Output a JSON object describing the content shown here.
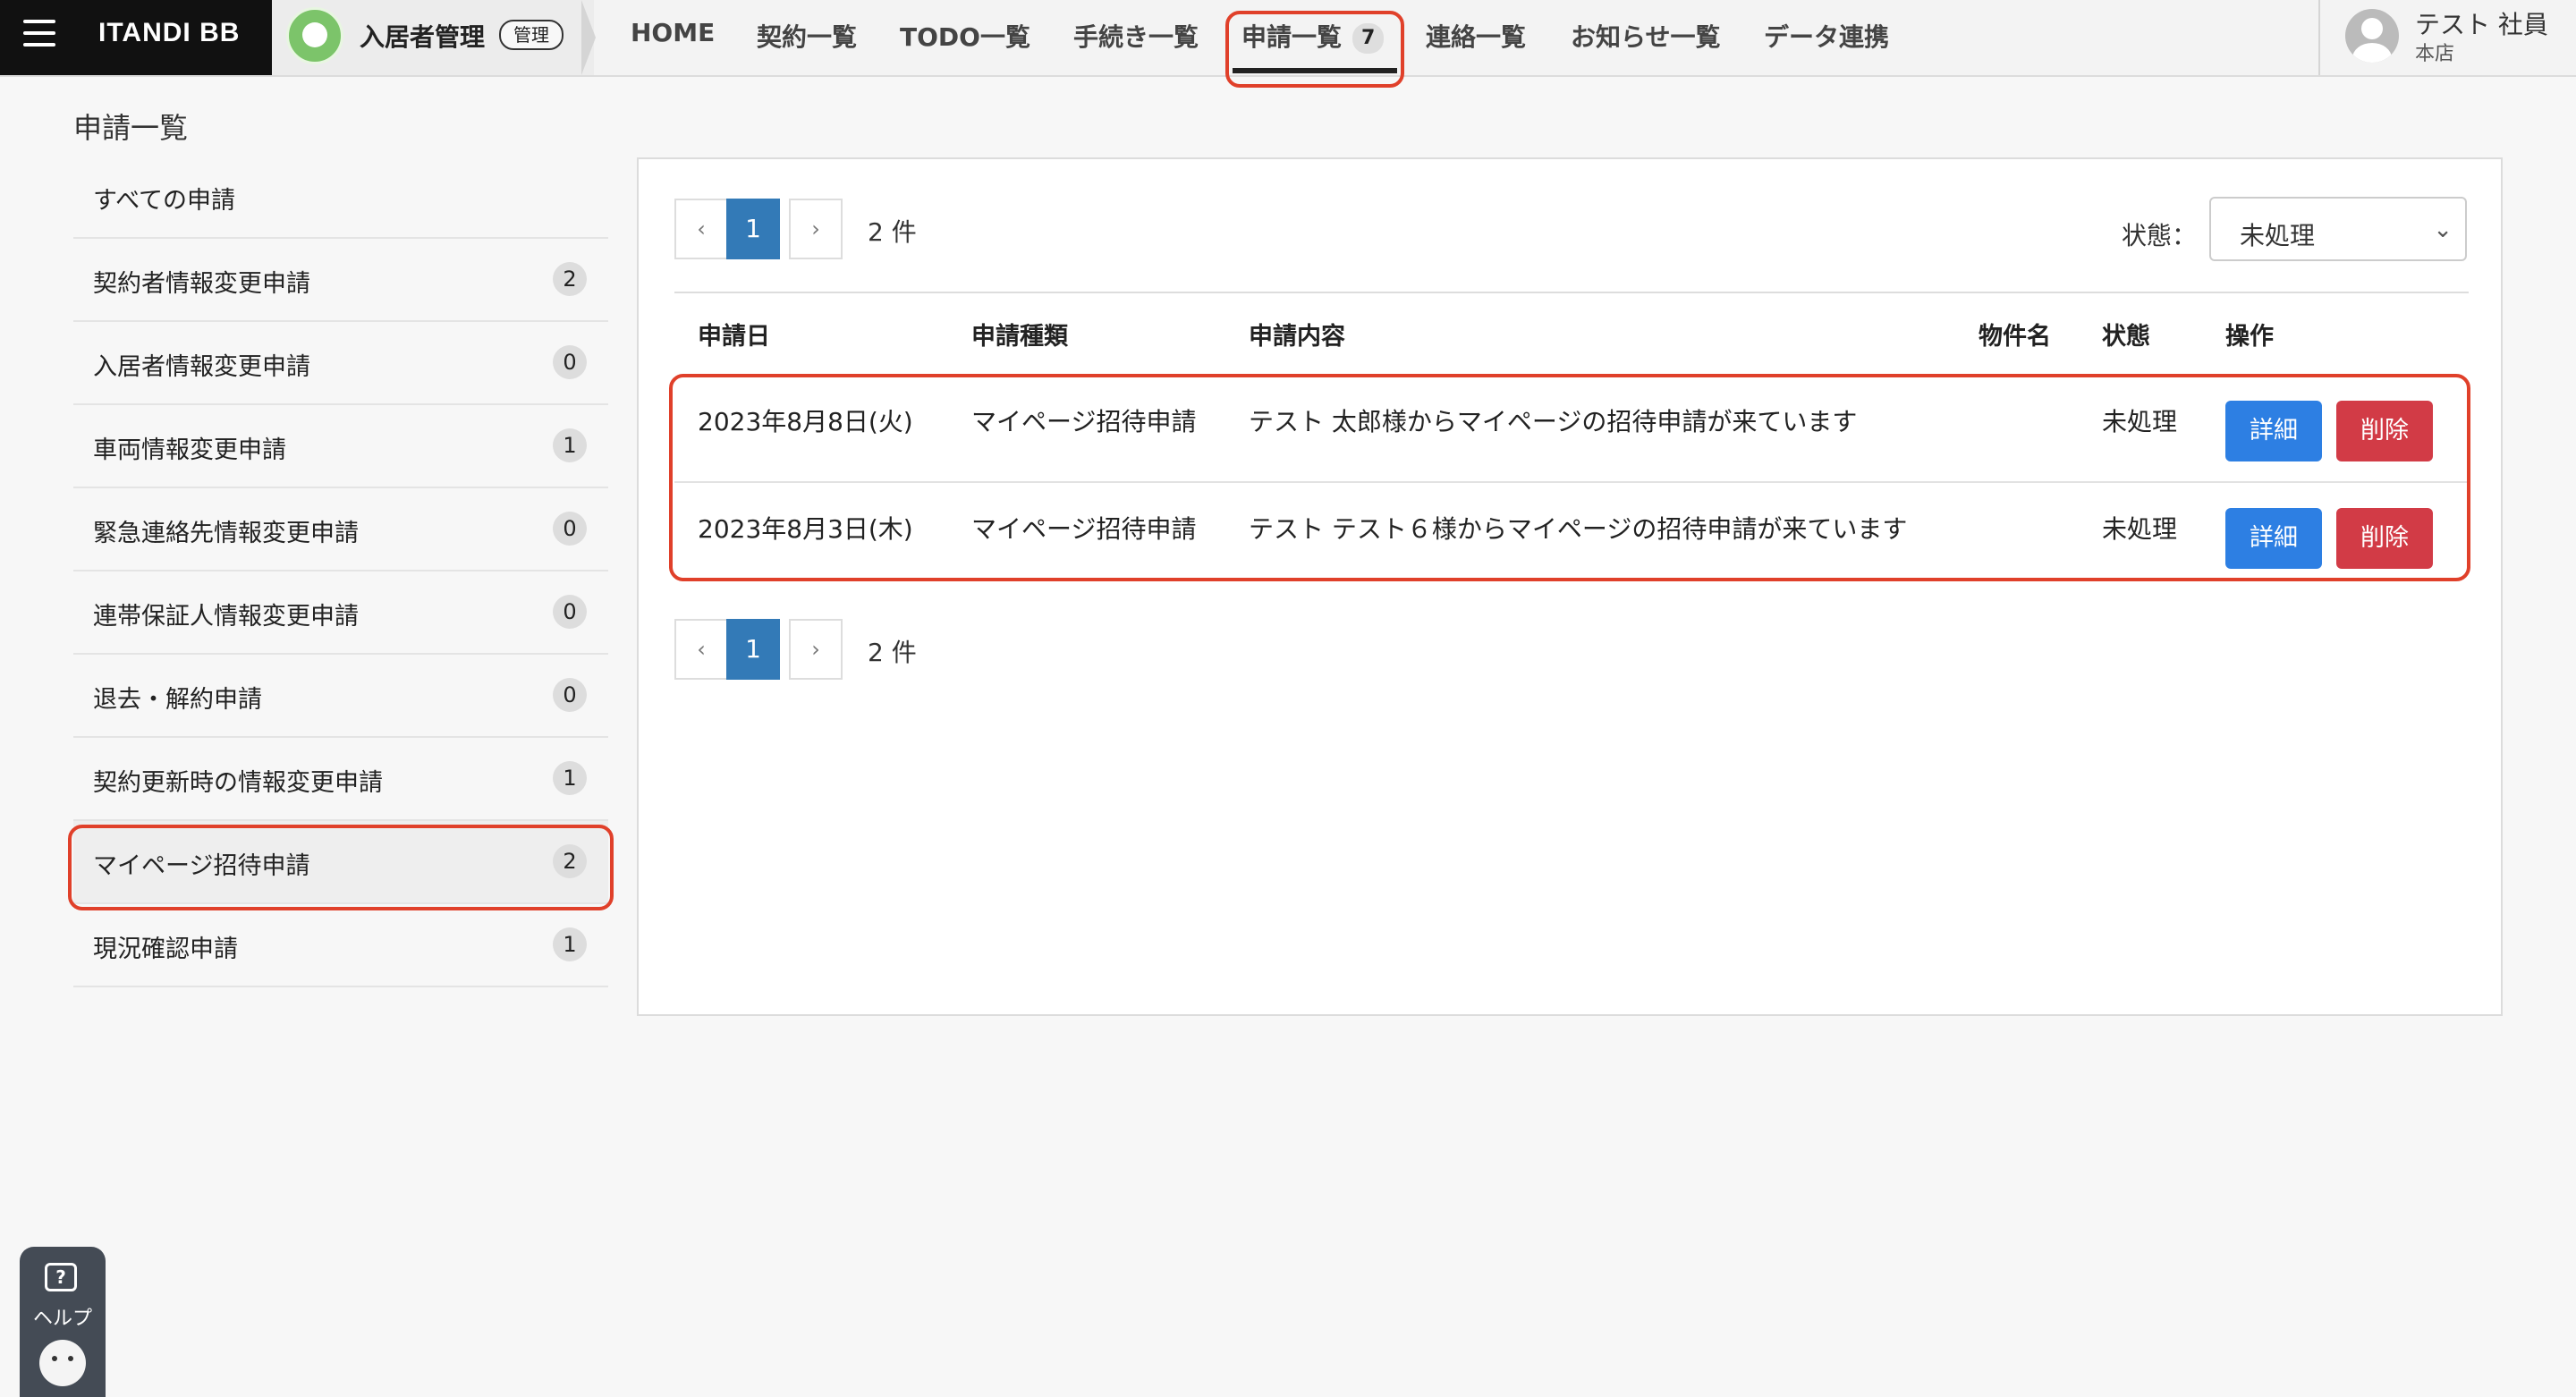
{
  "app": {
    "brand": "ITANDI BB",
    "menu_icon": "hamburger-menu-icon"
  },
  "module": {
    "title": "入居者管理",
    "badge": "管理"
  },
  "nav": [
    {
      "label": "HOME"
    },
    {
      "label": "契約一覧"
    },
    {
      "label": "TODO一覧"
    },
    {
      "label": "手続き一覧"
    },
    {
      "label": "申請一覧",
      "count": "7",
      "active": true
    },
    {
      "label": "連絡一覧"
    },
    {
      "label": "お知らせ一覧"
    },
    {
      "label": "データ連携"
    }
  ],
  "user": {
    "name": "テスト 社員",
    "store": "本店"
  },
  "page": {
    "title": "申請一覧"
  },
  "sidebar": {
    "items": [
      {
        "label": "すべての申請"
      },
      {
        "label": "契約者情報変更申請",
        "count": "2"
      },
      {
        "label": "入居者情報変更申請",
        "count": "0"
      },
      {
        "label": "車両情報変更申請",
        "count": "1"
      },
      {
        "label": "緊急連絡先情報変更申請",
        "count": "0"
      },
      {
        "label": "連帯保証人情報変更申請",
        "count": "0"
      },
      {
        "label": "退去・解約申請",
        "count": "0"
      },
      {
        "label": "契約更新時の情報変更申請",
        "count": "1"
      },
      {
        "label": "マイページ招待申請",
        "count": "2",
        "active": true
      },
      {
        "label": "現況確認申請",
        "count": "1"
      }
    ]
  },
  "pagination": {
    "prev": "‹",
    "current": "1",
    "next": "›",
    "total": "2 件"
  },
  "filter": {
    "label": "状態：",
    "value": "未処理"
  },
  "table": {
    "headers": [
      "申請日",
      "申請種類",
      "申請内容",
      "物件名",
      "状態",
      "操作"
    ],
    "rows": [
      {
        "date": "2023年8月8日(火)",
        "type": "マイページ招待申請",
        "content": "テスト 太郎様からマイページの招待申請が来ています",
        "property": "",
        "status": "未処理",
        "detail": "詳細",
        "delete": "削除"
      },
      {
        "date": "2023年8月3日(木)",
        "type": "マイページ招待申請",
        "content": "テスト テスト６様からマイページの招待申請が来ています",
        "property": "",
        "status": "未処理",
        "detail": "詳細",
        "delete": "削除"
      }
    ]
  },
  "help": {
    "label": "ヘルプ",
    "icon_glyph": "?"
  },
  "colors": {
    "highlight": "#e0402a",
    "primary": "#2d7fe3",
    "danger": "#d23b46",
    "page_active": "#337ab7"
  }
}
